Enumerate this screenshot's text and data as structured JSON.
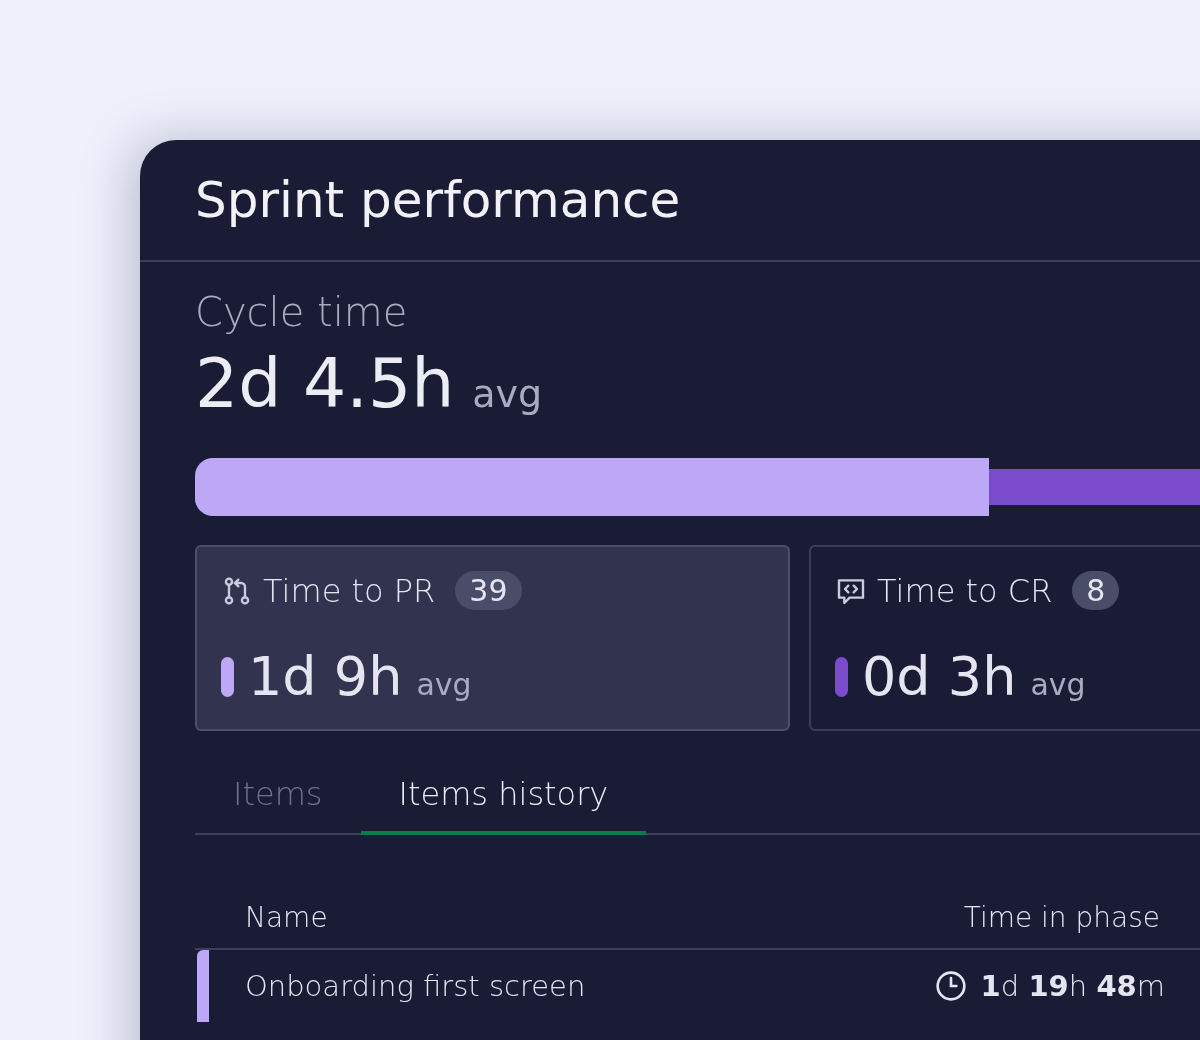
{
  "panel": {
    "title": "Sprint performance"
  },
  "cycle_time": {
    "label": "Cycle time",
    "value": "2d 4.5h",
    "unit": "avg"
  },
  "breakdown_bar": {
    "level": 0.79
  },
  "cards": [
    {
      "kind": "pull-request",
      "title": "Time to PR",
      "count": "39",
      "value": "1d 9h",
      "unit": "avg",
      "color": "#bda8f8",
      "selected": true
    },
    {
      "kind": "code-review",
      "title": "Time to CR",
      "count": "8",
      "value": "0d 3h",
      "unit": "avg",
      "color": "#7a4bcd",
      "selected": false
    }
  ],
  "tabs": [
    {
      "label": "Items",
      "selected": false
    },
    {
      "label": "Items history",
      "selected": true
    }
  ],
  "table": {
    "columns": [
      "Name",
      "Time in phase"
    ],
    "rows": [
      {
        "name": "Onboarding first screen",
        "time": "**1**d **19**h **48**m",
        "color": "#bda8f8"
      }
    ]
  }
}
